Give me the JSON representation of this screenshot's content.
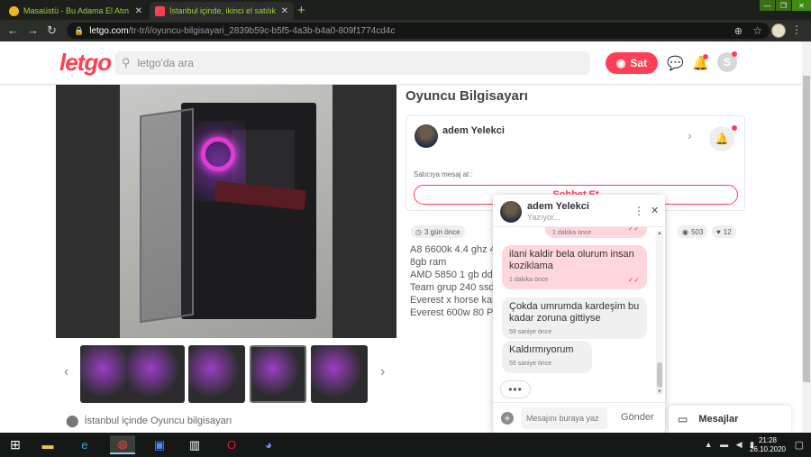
{
  "browser": {
    "tabs": [
      {
        "title": "Masaüstü - Bu Adama El Atın | Sa",
        "favicon_color": "#f2b51c"
      },
      {
        "title": "İstanbul içinde, ikinci el satılık Oy",
        "favicon_color": "#ff3f55"
      }
    ],
    "new_tab": "+",
    "url_host": "letgo.com",
    "url_path": "/tr-tr/i/oyuncu-bilgisayari_2839b59c-b5f5-4a3b-b4a0-809f1774cd4c"
  },
  "header": {
    "logo": "letgo",
    "search_placeholder": "letgo'da ara",
    "sell_label": "Sat",
    "avatar_letter": "S",
    "brand_color": "#ff3f55"
  },
  "listing": {
    "title": "Oyuncu Bilgisayarı",
    "location": "İstanbul içinde Oyuncu bilgisayarı",
    "posted": "3 gün önce",
    "views": "503",
    "likes": "12",
    "description": [
      "A8 6600k 4.4 ghz 4",
      "8gb ram",
      "AMD 5850 1 gb ddr",
      "Team grup 240 ssd",
      "Everest x horse kas",
      "Everest 600w 80 Pl"
    ]
  },
  "seller": {
    "name": "adem Yelekci",
    "message_label": "Satıcıya mesaj at :",
    "chat_button": "Sohbet Et"
  },
  "chat": {
    "name": "adem Yelekci",
    "status": "Yazıyor...",
    "messages": [
      {
        "from": "me",
        "text": "",
        "time": "1 dakika önce"
      },
      {
        "from": "me",
        "text": "ilani kaldir bela olurum insan koziklama",
        "time": "1 dakika önce"
      },
      {
        "from": "them",
        "text": "Çokda umrumda kardeşim bu kadar zoruna gittiyse",
        "time": "59 saniye önce"
      },
      {
        "from": "them",
        "text": "Kaldırmıyorum",
        "time": "55 saniye önce"
      }
    ],
    "typing": "•••",
    "input_placeholder": "Mesajını buraya yaz",
    "send_label": "Gönder"
  },
  "messages_bar": {
    "label": "Mesajlar"
  },
  "taskbar": {
    "time": "21:28",
    "date": "26.10.2020"
  }
}
